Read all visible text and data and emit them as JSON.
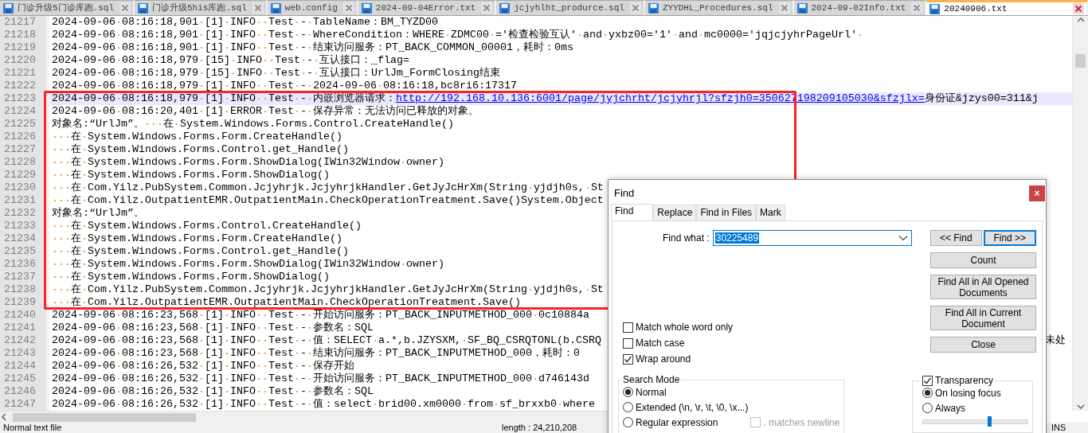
{
  "tabs": [
    {
      "label": "门诊升级5门诊库跑.sql",
      "selected": false
    },
    {
      "label": "门诊升级5his库跑.sql",
      "selected": false
    },
    {
      "label": "web.config",
      "selected": false
    },
    {
      "label": "2024-09-04Error.txt",
      "selected": false
    },
    {
      "label": "jcjyhlht_produrce.sql",
      "selected": false
    },
    {
      "label": "ZYYDHL_Procedures.sql",
      "selected": false
    },
    {
      "label": "2024-09-02Info.txt",
      "selected": false
    },
    {
      "label": "20240906.txt",
      "selected": true
    }
  ],
  "editor": {
    "lines": [
      {
        "number": "21217",
        "current": false,
        "text": "2024-09-06 08:16:18,901 [1] INFO  Test - TableName：BM_TYZD00"
      },
      {
        "number": "21218",
        "current": false,
        "text": "2024-09-06 08:16:18,901 [1] INFO  Test - WhereCondition：WHERE ZDMC00 ='检查检验互认' and yxbz00='1' and mc0000='jqjcjyhrPageUrl' "
      },
      {
        "number": "21219",
        "current": false,
        "text": "2024-09-06 08:16:18,901 [1] INFO  Test - 结束访问服务：PT_BACK_COMMON_00001，耗时：0ms"
      },
      {
        "number": "21220",
        "current": false,
        "text": "2024-09-06 08:16:18,979 [15] INFO  Test - 互认接口：_flag="
      },
      {
        "number": "21221",
        "current": false,
        "text": "2024-09-06 08:16:18,979 [15] INFO  Test - 互认接口：UrlJm_FormClosing结束"
      },
      {
        "number": "21222",
        "current": false,
        "text": "2024-09-06 08:16:18,979 [1] INFO  Test - 2024-09-06 08:16:18,bc8ri6:17317"
      },
      {
        "number": "21223",
        "current": true,
        "text": "2024-09-06 08:16:18,979 [1] INFO  Test - 内嵌浏览器请求：",
        "link": "http://192.168.10.136:6001/page/jyjchrht/jcjyhrjl?sfzjh0=350627198209105030&sfzjlx=",
        "text_after": "身份证&jzys00=311&j"
      },
      {
        "number": "21224",
        "current": false,
        "text": "2024-09-06 08:16:20,401 [1] ERROR Test - 保存异常：无法访问已释放的对象。"
      },
      {
        "number": "21225",
        "current": false,
        "text": "对象名:“UrlJm”。   在 System.Windows.Forms.Control.CreateHandle()"
      },
      {
        "number": "21226",
        "current": false,
        "text": "   在 System.Windows.Forms.Form.CreateHandle()"
      },
      {
        "number": "21227",
        "current": false,
        "text": "   在 System.Windows.Forms.Control.get_Handle()"
      },
      {
        "number": "21228",
        "current": false,
        "text": "   在 System.Windows.Forms.Form.ShowDialog(IWin32Window owner)"
      },
      {
        "number": "21229",
        "current": false,
        "text": "   在 System.Windows.Forms.Form.ShowDialog()"
      },
      {
        "number": "21230",
        "current": false,
        "text": "   在 Com.Yilz.PubSystem.Common.Jcjyhrjk.JcjyhrjkHandler.GetJyJcHrXm(String yjdjh0s, St"
      },
      {
        "number": "21231",
        "current": false,
        "text": "   在 Com.Yilz.OutpatientEMR.OutpatientMain.CheckOperationTreatment.Save()System.Object"
      },
      {
        "number": "21232",
        "current": false,
        "text": "对象名:“UrlJm”。"
      },
      {
        "number": "21233",
        "current": false,
        "text": "   在 System.Windows.Forms.Control.CreateHandle()"
      },
      {
        "number": "21234",
        "current": false,
        "text": "   在 System.Windows.Forms.Form.CreateHandle()"
      },
      {
        "number": "21235",
        "current": false,
        "text": "   在 System.Windows.Forms.Control.get_Handle()"
      },
      {
        "number": "21236",
        "current": false,
        "text": "   在 System.Windows.Forms.Form.ShowDialog(IWin32Window owner)"
      },
      {
        "number": "21237",
        "current": false,
        "text": "   在 System.Windows.Forms.Form.ShowDialog()"
      },
      {
        "number": "21238",
        "current": false,
        "text": "   在 Com.Yilz.PubSystem.Common.Jcjyhrjk.JcjyhrjkHandler.GetJyJcHrXm(String yjdjh0s, St"
      },
      {
        "number": "21239",
        "current": false,
        "text": "   在 Com.Yilz.OutpatientEMR.OutpatientMain.CheckOperationTreatment.Save()"
      },
      {
        "number": "21240",
        "current": false,
        "text": "2024-09-06 08:16:23,568 [1] INFO  Test - 开始访问服务：PT_BACK_INPUTMETHOD_000 0c10884a"
      },
      {
        "number": "21241",
        "current": false,
        "text": "2024-09-06 08:16:23,568 [1] INFO  Test - 参数名：SQL"
      },
      {
        "number": "21242",
        "current": false,
        "text": "2024-09-06 08:16:23,568 [1] INFO  Test - 值：SELECT a.*,b.JZYSXM, SF_BQ_CSRQTONL(b.CSRQ",
        "tail": "未处"
      },
      {
        "number": "21243",
        "current": false,
        "text": "2024-09-06 08:16:23,568 [1] INFO  Test - 结束访问服务：PT_BACK_INPUTMETHOD_000，耗时：0"
      },
      {
        "number": "21244",
        "current": false,
        "text": "2024-09-06 08:16:26,532 [1] INFO  Test - 保存开始"
      },
      {
        "number": "21245",
        "current": false,
        "text": "2024-09-06 08:16:26,532 [1] INFO  Test - 开始访问服务：PT_BACK_INPUTMETHOD_000 d746143d"
      },
      {
        "number": "21246",
        "current": false,
        "text": "2024-09-06 08:16:26,532 [1] INFO  Test - 参数名：SQL"
      },
      {
        "number": "21247",
        "current": false,
        "text": "2024-09-06 08:16:26,532 [1] INFO  Test - 值：select brid00.xm0000 from sf_brxxb0 where"
      }
    ]
  },
  "find_dialog": {
    "title": "Find",
    "close_label": "×",
    "tabs": [
      {
        "label": "Find",
        "selected": true
      },
      {
        "label": "Replace",
        "selected": false
      },
      {
        "label": "Find in Files",
        "selected": false
      },
      {
        "label": "Mark",
        "selected": false
      }
    ],
    "find_what": {
      "label": "Find what :",
      "value": "30225489"
    },
    "nav_buttons": [
      {
        "label": "<< Find",
        "default": false
      },
      {
        "label": "Find >>",
        "default": true
      }
    ],
    "buttons": [
      "Count",
      "Find All in All Opened Documents",
      "Find All in Current Document",
      "Close"
    ],
    "options": [
      {
        "label": "Match whole word only",
        "checked": false
      },
      {
        "label": "Match case",
        "checked": false
      },
      {
        "label": "Wrap around",
        "checked": true
      }
    ],
    "search_mode": {
      "title": "Search Mode",
      "modes": [
        {
          "label": "Normal",
          "selected": true
        },
        {
          "label": "Extended (\\n, \\r, \\t, \\0, \\x...)",
          "selected": false
        },
        {
          "label": "Regular expression",
          "selected": false
        }
      ],
      "matches_newline": {
        "label": ". matches newline",
        "checked": false,
        "disabled": true
      }
    },
    "transparency": {
      "label": "Transparency",
      "checked": true,
      "options": [
        {
          "label": "On losing focus",
          "selected": true
        },
        {
          "label": "Always",
          "selected": false
        }
      ],
      "level": 0.64
    }
  },
  "status_bar": {
    "items": [
      "Normal text file",
      "length : 24,210,208",
      "INS"
    ]
  }
}
